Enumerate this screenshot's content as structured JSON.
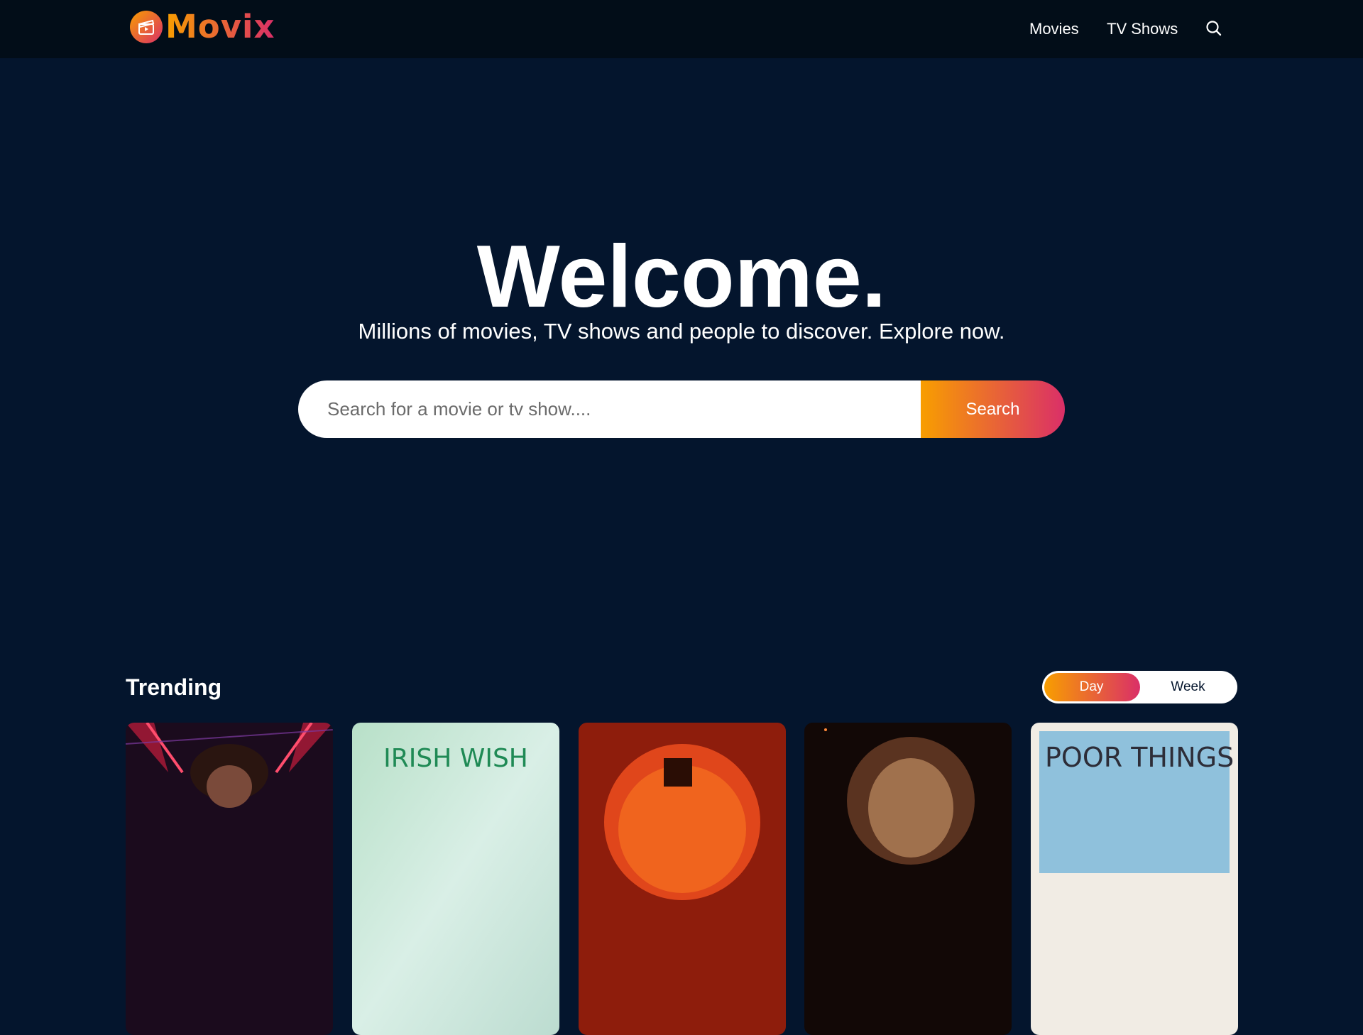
{
  "header": {
    "logo_text": "Movix",
    "nav": [
      {
        "label": "Movies"
      },
      {
        "label": "TV Shows"
      }
    ],
    "search_icon": "search-icon"
  },
  "hero": {
    "title": "Welcome.",
    "subtitle": "Millions of movies, TV shows and people to discover. Explore now.",
    "search_placeholder": "Search for a movie or tv show....",
    "search_button": "Search"
  },
  "trending": {
    "title": "Trending",
    "tabs": [
      {
        "label": "Day",
        "active": true
      },
      {
        "label": "Week",
        "active": false
      }
    ],
    "cards": [
      {
        "poster_text": ""
      },
      {
        "poster_text": "IRISH WISH"
      },
      {
        "poster_text": ""
      },
      {
        "poster_text": ""
      },
      {
        "poster_text": "POOR THINGS"
      }
    ]
  },
  "colors": {
    "background": "#04152d",
    "header": "#020d18",
    "gradient_start": "#f89e00",
    "gradient_end": "#da2f68"
  }
}
